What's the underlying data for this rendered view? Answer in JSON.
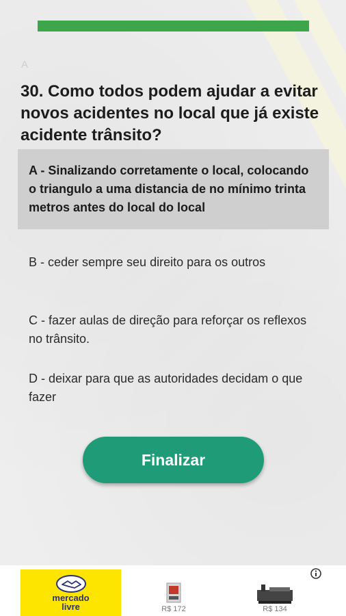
{
  "progress": {
    "fraction": 1.0,
    "color": "#3da64a"
  },
  "hint_letter": "A",
  "question": {
    "number": "30.",
    "text": "30. Como todos podem ajudar a evitar novos acidentes no local que já existe acidente trânsito?"
  },
  "options": [
    {
      "label": "A - Sinalizando corretamente o local, colocando o triangulo a uma distancia de no mínimo trinta metros antes do local do local",
      "selected": true
    },
    {
      "label": "B - ceder sempre seu direito para os outros",
      "selected": false
    },
    {
      "label": "C - fazer aulas de direção para reforçar os reflexos no trânsito.",
      "selected": false
    },
    {
      "label": "D - deixar para que as autoridades decidam o que fazer",
      "selected": false
    }
  ],
  "finalize_button": {
    "label": "Finalizar",
    "color": "#1f9b78"
  },
  "ad": {
    "brand": {
      "line1": "mercado",
      "line2": "livre",
      "color": "#fde500"
    },
    "items": [
      {
        "price": "R$ 172",
        "icon": "product-box-icon"
      },
      {
        "price": "R$ 134",
        "icon": "product-machine-icon"
      }
    ],
    "info_icon": "info-icon"
  }
}
